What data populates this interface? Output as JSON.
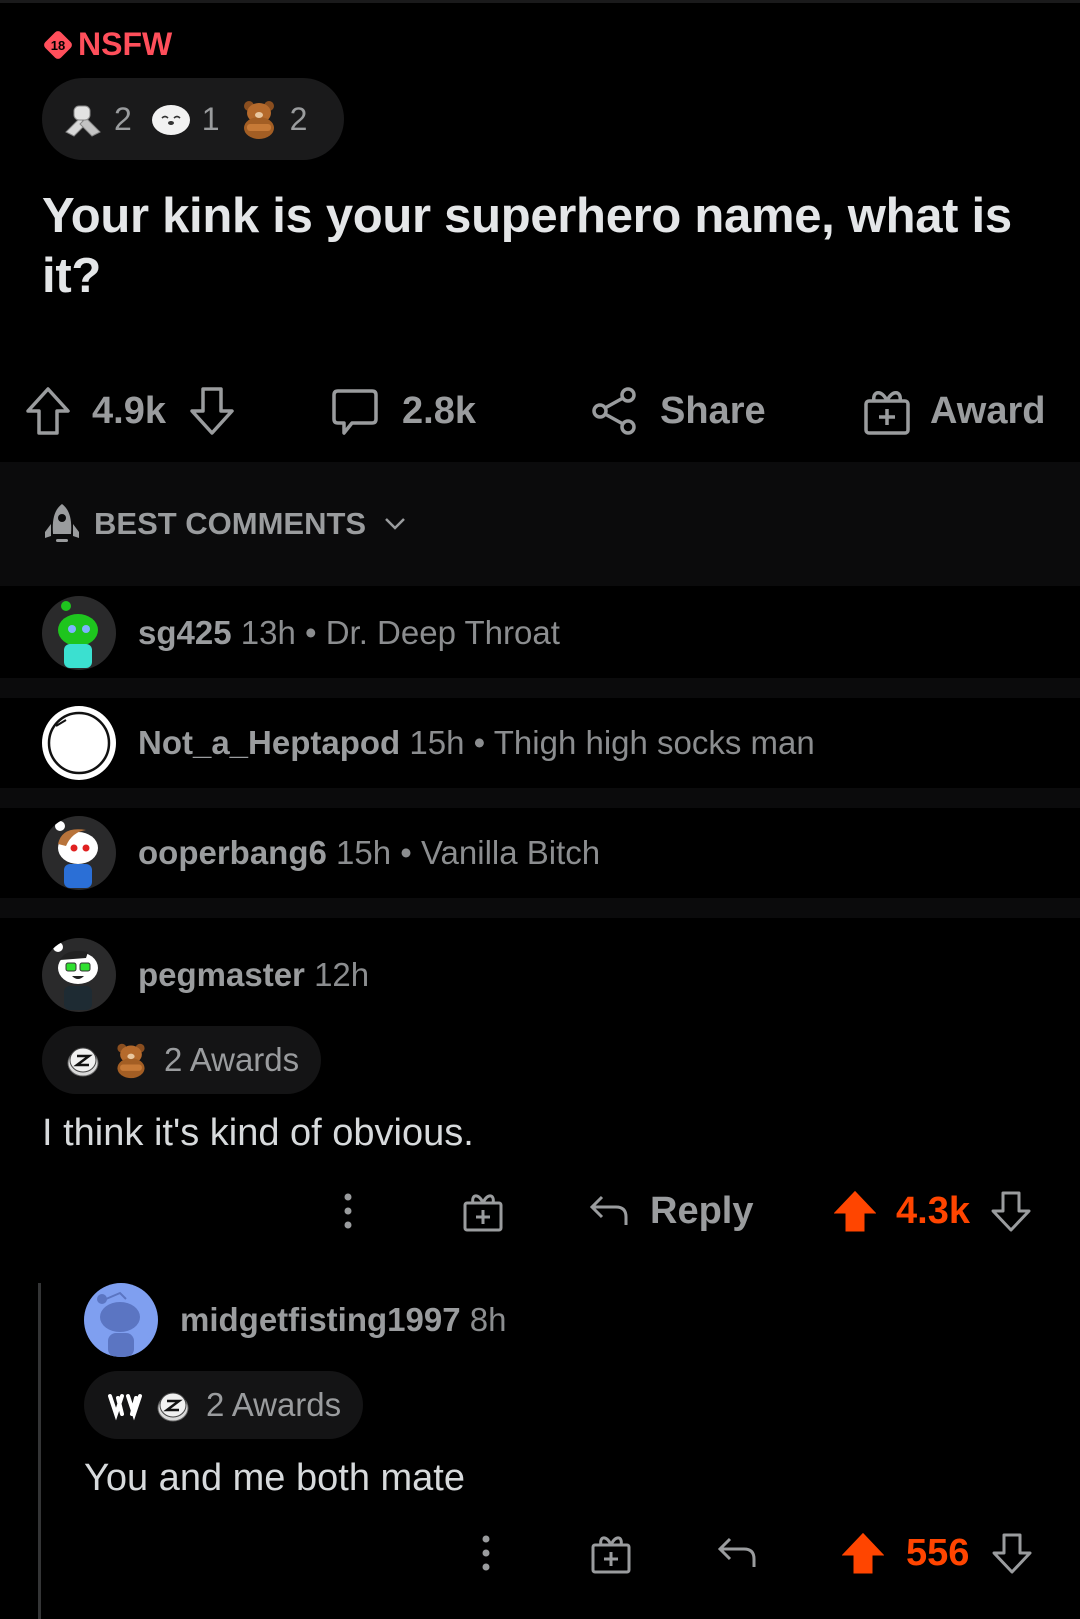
{
  "post": {
    "nsfw_label": "NSFW",
    "nsfw_badge": "18",
    "awards": [
      {
        "icon": "arm-wrestle-award-icon",
        "count": "2"
      },
      {
        "icon": "seal-award-icon",
        "count": "1"
      },
      {
        "icon": "bear-award-icon",
        "count": "2"
      }
    ],
    "title": "Your kink is your superhero name, what is it?",
    "actions": {
      "score": "4.9k",
      "comments": "2.8k",
      "share_label": "Share",
      "award_label": "Award"
    }
  },
  "sort": {
    "label": "BEST COMMENTS",
    "icon": "rocket-icon"
  },
  "collapsed_comments": [
    {
      "user": "sg425",
      "age": "13h",
      "separator": "•",
      "preview": "Dr. Deep Throat",
      "avatar_color": "#2a2a2b"
    },
    {
      "user": "Not_a_Heptapod",
      "age": "15h",
      "separator": "•",
      "preview": "Thigh high socks man",
      "avatar_color": "#ffffff"
    },
    {
      "user": "ooperbang6",
      "age": "15h",
      "separator": "•",
      "preview": "Vanilla Bitch",
      "avatar_color": "#2a2a2b"
    }
  ],
  "comments": [
    {
      "user": "pegmaster",
      "age": "12h",
      "awards_label": "2 Awards",
      "award_icons": [
        "silver-award-icon",
        "bear-award-icon"
      ],
      "body": "I think it's kind of obvious.",
      "reply_label": "Reply",
      "score": "4.3k",
      "upvoted": true
    },
    {
      "user": "midgetfisting1997",
      "age": "8h",
      "awards_label": "2 Awards",
      "award_icons": [
        "hands-award-icon",
        "silver-award-icon"
      ],
      "body": "You and me both mate",
      "score": "556",
      "upvoted": true
    }
  ],
  "colors": {
    "background": "#000000",
    "nsfw": "#ff4f5b",
    "upvote": "#ff4500",
    "muted_text": "#9a9c9e",
    "pill_background": "#1a1a1b"
  }
}
